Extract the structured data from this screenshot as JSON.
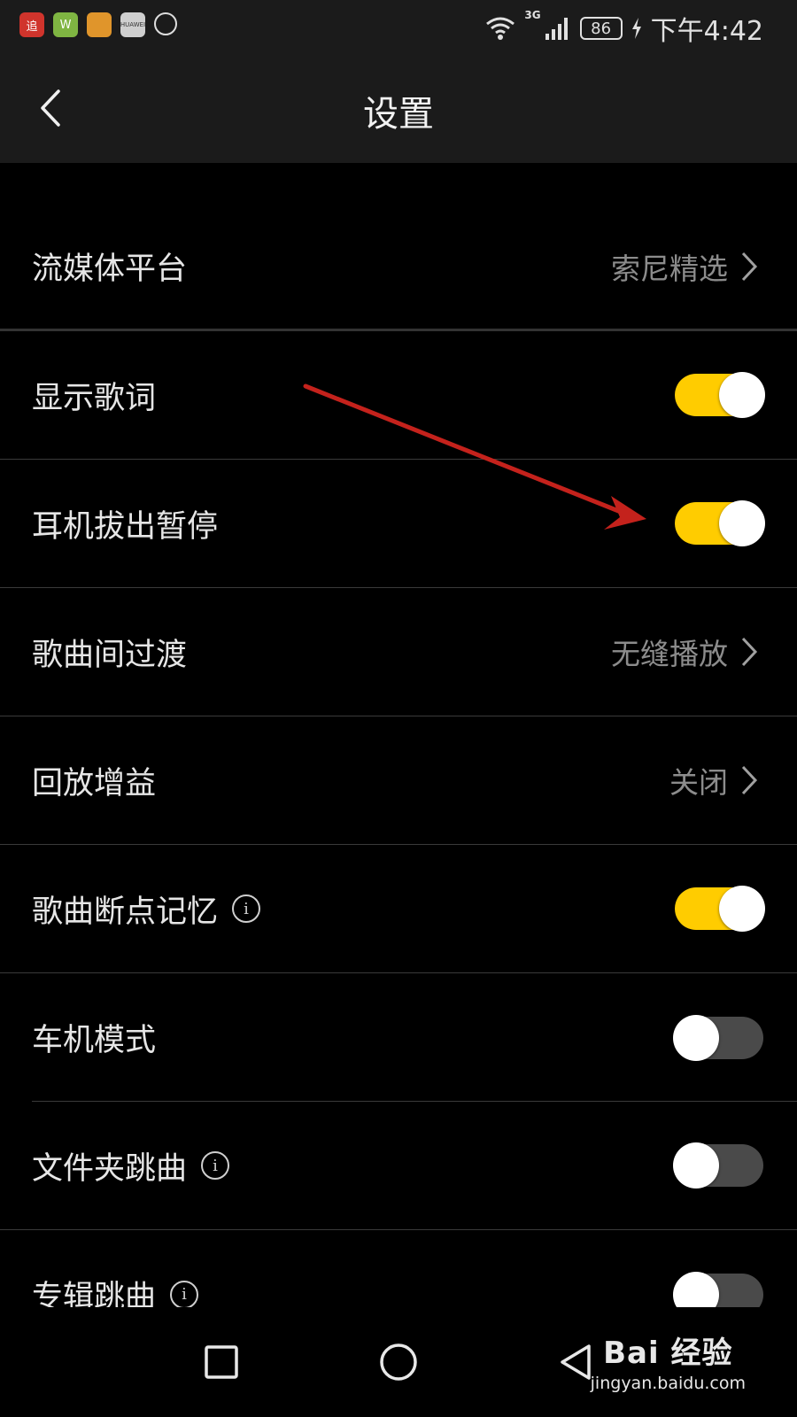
{
  "status_bar": {
    "app_icons": [
      "追",
      "W",
      "",
      "HUAWEI",
      ""
    ],
    "network": "3G",
    "battery": "86",
    "time": "下午4:42"
  },
  "header": {
    "title": "设置"
  },
  "settings": [
    {
      "label": "流媒体平台",
      "type": "link",
      "value": "索尼精选"
    },
    {
      "label": "显示歌词",
      "type": "toggle",
      "on": true
    },
    {
      "label": "耳机拔出暂停",
      "type": "toggle",
      "on": true
    },
    {
      "label": "歌曲间过渡",
      "type": "link",
      "value": "无缝播放"
    },
    {
      "label": "回放增益",
      "type": "link",
      "value": "关闭"
    },
    {
      "label": "歌曲断点记忆",
      "type": "toggle",
      "on": true,
      "info": true
    },
    {
      "label": "车机模式",
      "type": "toggle",
      "on": false
    },
    {
      "label": "文件夹跳曲",
      "type": "toggle",
      "on": false,
      "info": true
    },
    {
      "label": "专辑跳曲",
      "type": "toggle",
      "on": false,
      "info": true
    }
  ],
  "info_glyph": "i",
  "colors": {
    "toggle_on": "#ffcc00",
    "toggle_off": "#4a4a4a",
    "annotation_arrow": "#c4221c"
  },
  "watermark": {
    "brand": "Bai  经验",
    "url": "jingyan.baidu.com"
  }
}
